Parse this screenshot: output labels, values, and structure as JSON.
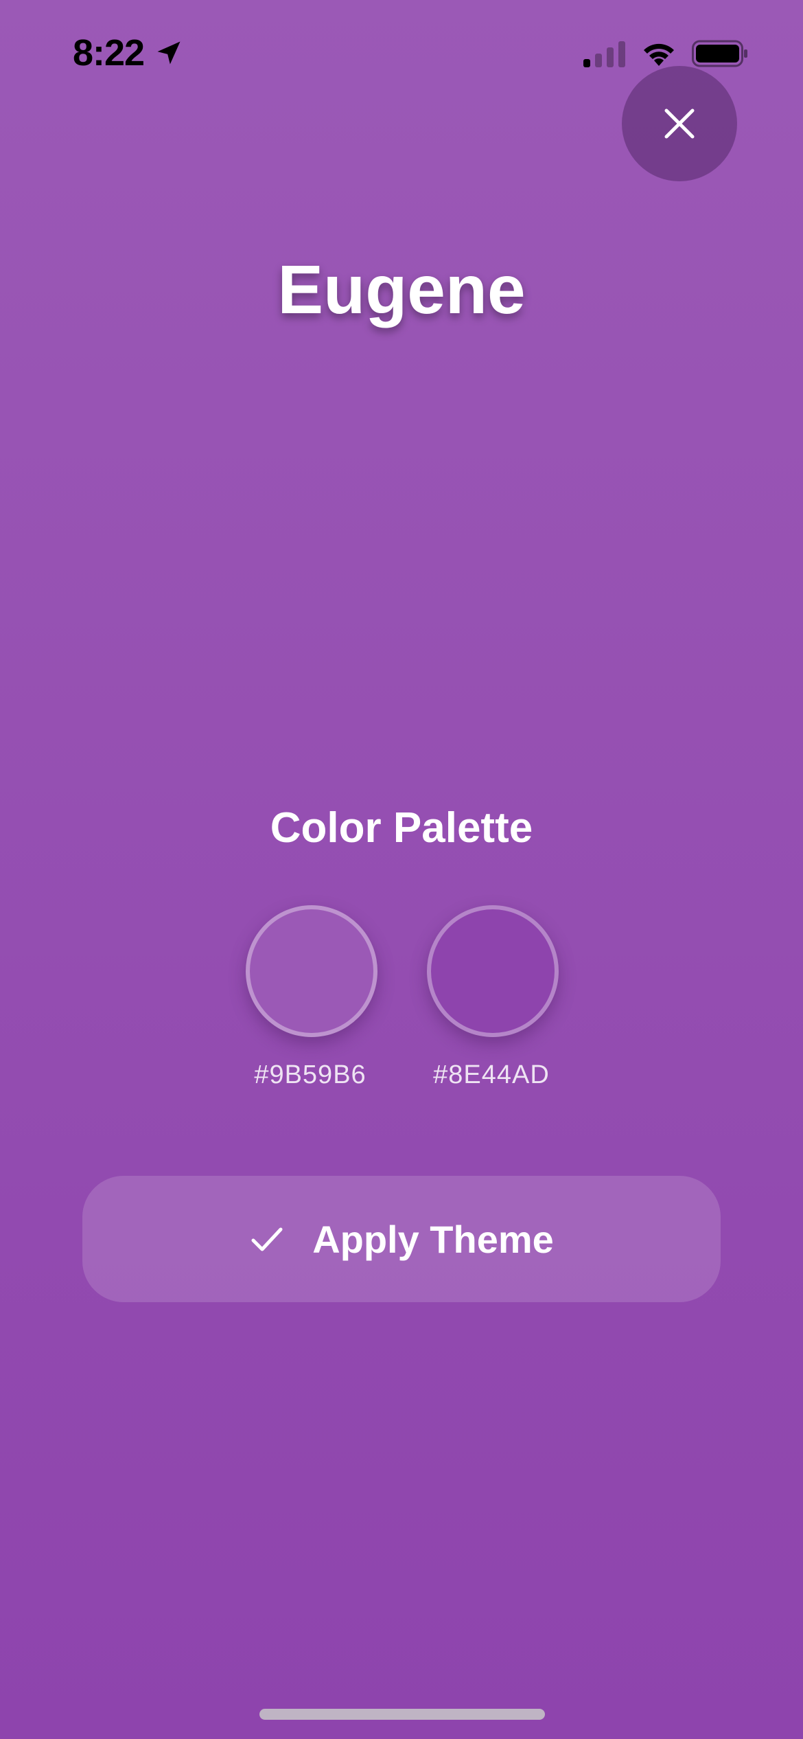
{
  "status_bar": {
    "time": "8:22",
    "location_icon": "location-arrow-icon",
    "signal_icon": "cellular-signal-icon",
    "wifi_icon": "wifi-icon",
    "battery_icon": "battery-icon"
  },
  "close_button": {
    "icon": "close-icon"
  },
  "title": "Eugene",
  "palette": {
    "heading": "Color Palette",
    "colors": [
      {
        "hex": "#9B59B6",
        "label": "#9B59B6"
      },
      {
        "hex": "#8E44AD",
        "label": "#8E44AD"
      }
    ]
  },
  "apply_button": {
    "icon": "checkmark-icon",
    "label": "Apply Theme"
  },
  "theme": {
    "gradient_top": "#9B59B6",
    "gradient_bottom": "#8E44AD",
    "text": "#FFFFFF"
  }
}
